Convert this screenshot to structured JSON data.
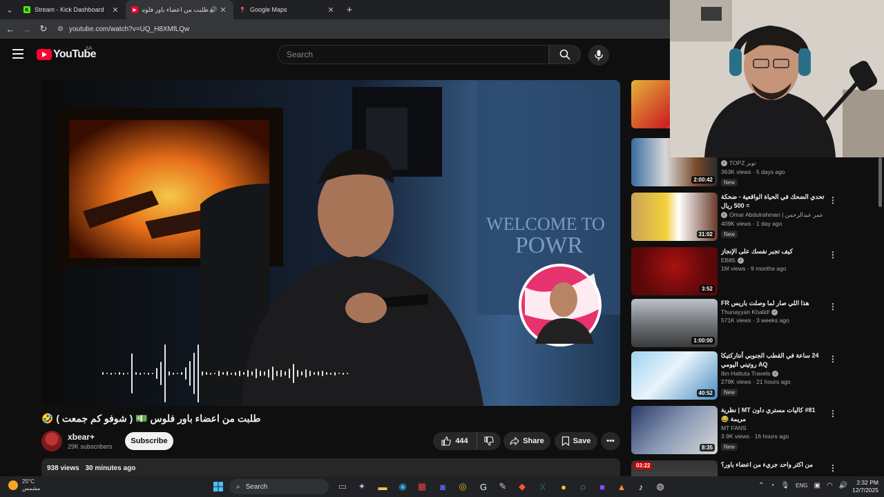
{
  "browser": {
    "tabs": [
      {
        "title": "Stream - Kick Dashboard",
        "favicon": "kick-icon"
      },
      {
        "title": "طلبت من اعضاء باور فلوس",
        "favicon": "youtube-icon"
      },
      {
        "title": "Google Maps",
        "favicon": "maps-icon"
      }
    ],
    "url": "youtube.com/watch?v=UQ_H8XMfLQw"
  },
  "youtube": {
    "logo_text": "YouTube",
    "country_code": "SA",
    "search_placeholder": "Search"
  },
  "video": {
    "title": "طلبت من اعضاء باور فلوس 💵 ( شوفو كم جمعت ) 🤣",
    "channel": "xbear+",
    "subscribers": "29K subscribers",
    "subscribe_label": "Subscribe",
    "likes": "444",
    "share_label": "Share",
    "save_label": "Save",
    "views": "938 views",
    "age": "30 minutes ago",
    "overlay_text": "WELCOME TO POWR"
  },
  "recommendations": [
    {
      "title": "",
      "channel": "TOPZ توبز",
      "views": "363K views · 5 days ago",
      "badge": "New",
      "duration": "2:00:42"
    },
    {
      "title": "تحدي الضحك في الحياة الواقعية - ضحكة = 500 ريال",
      "channel": "Omar Abdulrahman | عمر عبدالرحمن",
      "views": "409K views · 1 day ago",
      "badge": "New",
      "duration": "31:02"
    },
    {
      "title": "كيف تجبر نفسك على الإنجاز",
      "channel": "EB85",
      "views": "1M views · 9 months ago",
      "badge": "",
      "duration": "3:52"
    },
    {
      "title": "هذا اللي صار لما وصلت باريس FR",
      "channel": "Thunayyan Khalid!",
      "views": "571K views · 3 weeks ago",
      "badge": "",
      "duration": "1:00:00"
    },
    {
      "title": "24 ساعة في القطب الجنوبي أنتاركتيكا AQ روتيني اليومي",
      "channel": "Ibn Hattuta Travels",
      "views": "279K views · 21 hours ago",
      "badge": "New",
      "duration": "40:52"
    },
    {
      "title": "#81 كاليات مستري داون MT | نظرية مريمة 😂",
      "channel": "MT FANS",
      "views": "3.9K views · 16 hours ago",
      "badge": "New",
      "duration": "8:35"
    },
    {
      "title": "من اكثر واحد جريء من اعضاء باور؟",
      "channel": "",
      "views": "",
      "badge": "",
      "duration": "03:22"
    }
  ],
  "taskbar": {
    "temperature": "25°C",
    "weather": "مشمس",
    "search_label": "Search",
    "lang": "ENG",
    "time": "2:32 PM",
    "date": "12/7/2025"
  },
  "colors": {
    "youtube_red": "#ff0033",
    "kick_green": "#53fc18",
    "bg": "#0f0f0f"
  }
}
